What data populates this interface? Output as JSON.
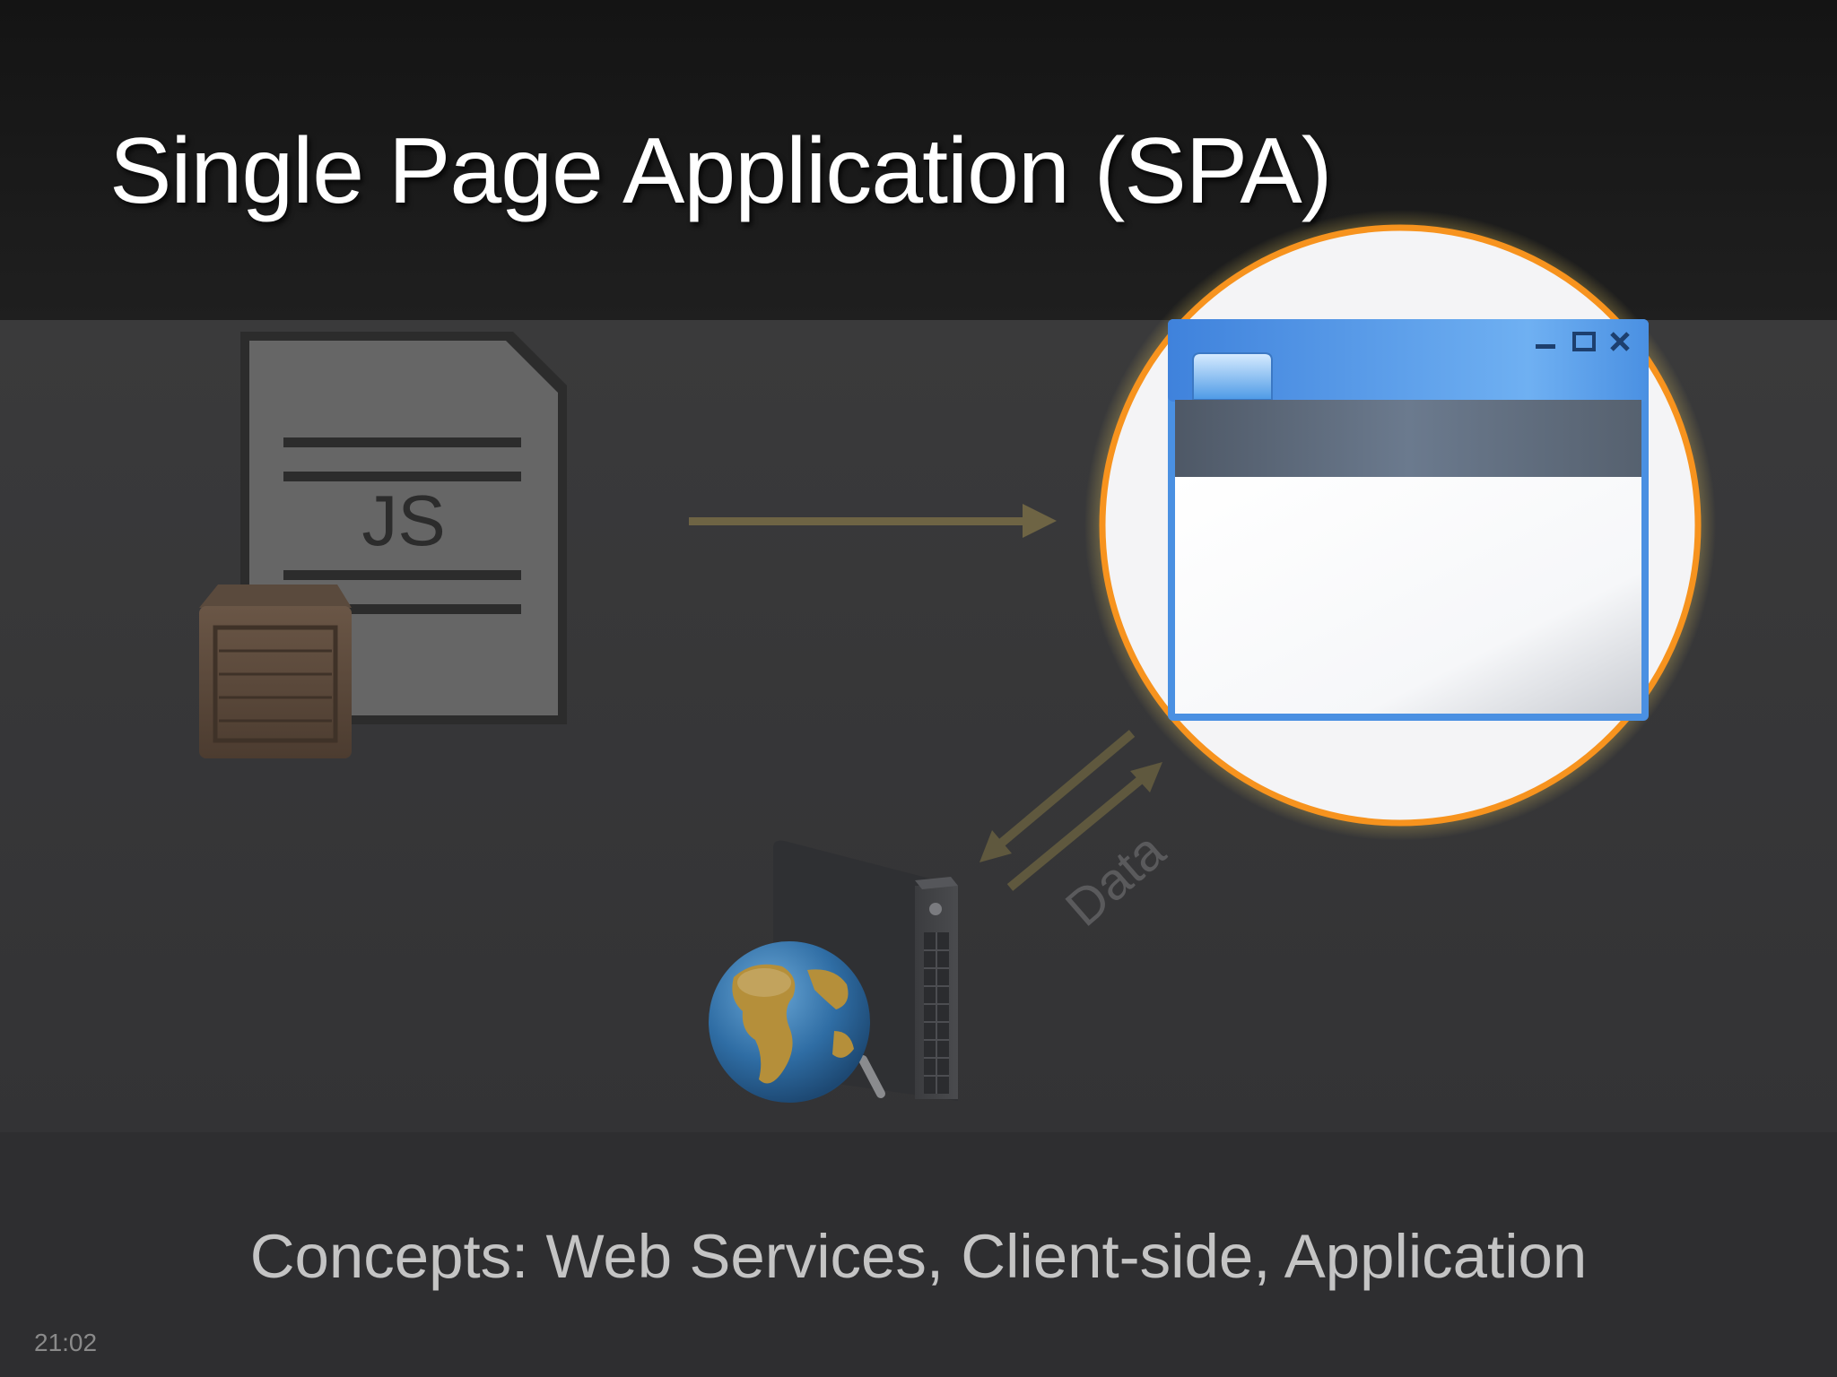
{
  "slide": {
    "title": "Single Page Application (SPA)",
    "concepts": "Concepts: Web Services, Client-side, Application",
    "timestamp": "21:02"
  },
  "diagram": {
    "js_file_label": "JS",
    "data_label": "Data",
    "icons": [
      "js-file-icon",
      "package-crate-icon",
      "browser-window-icon",
      "server-tower-icon",
      "globe-icon"
    ],
    "colors": {
      "highlight_ring": "#f7931e",
      "arrow": "#6e6444",
      "window_frame": "#4a90e2"
    }
  }
}
